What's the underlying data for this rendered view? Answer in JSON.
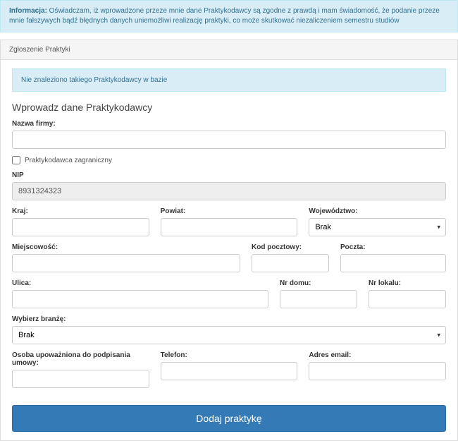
{
  "info_banner": {
    "label": "Informacja:",
    "text": " Oświadczam, iż wprowadzone przeze mnie dane Praktykodawcy są zgodne z prawdą i mam świadomość, że podanie przeze mnie fałszywych bądź błędnych danych uniemożliwi realizację praktyki, co może skutkować niezaliczeniem semestru studiów"
  },
  "panel": {
    "heading": "Zgłoszenie Praktyki",
    "alert": "Nie znaleziono takiego Praktykodawcy w bazie"
  },
  "form": {
    "title": "Wprowadz dane Praktykodawcy",
    "company_name": {
      "label": "Nazwa firmy:",
      "value": ""
    },
    "foreign": {
      "label": "Praktykodawca zagraniczny",
      "checked": false
    },
    "nip": {
      "label": "NIP",
      "value": "8931324323"
    },
    "country": {
      "label": "Kraj:",
      "value": ""
    },
    "district": {
      "label": "Powiat:",
      "value": ""
    },
    "voivodeship": {
      "label": "Województwo:",
      "value": "Brak",
      "options": [
        "Brak"
      ]
    },
    "city": {
      "label": "Miejscowość:",
      "value": ""
    },
    "postal_code": {
      "label": "Kod pocztowy:",
      "value": ""
    },
    "post": {
      "label": "Poczta:",
      "value": ""
    },
    "street": {
      "label": "Ulica:",
      "value": ""
    },
    "house_no": {
      "label": "Nr domu:",
      "value": ""
    },
    "flat_no": {
      "label": "Nr lokalu:",
      "value": ""
    },
    "industry": {
      "label": "Wybierz branżę:",
      "value": "Brak",
      "options": [
        "Brak"
      ]
    },
    "authorized_person": {
      "label": "Osoba upoważniona do podpisania umowy:",
      "value": ""
    },
    "phone": {
      "label": "Telefon:",
      "value": ""
    },
    "email": {
      "label": "Adres email:",
      "value": ""
    },
    "submit": "Dodaj praktykę"
  }
}
